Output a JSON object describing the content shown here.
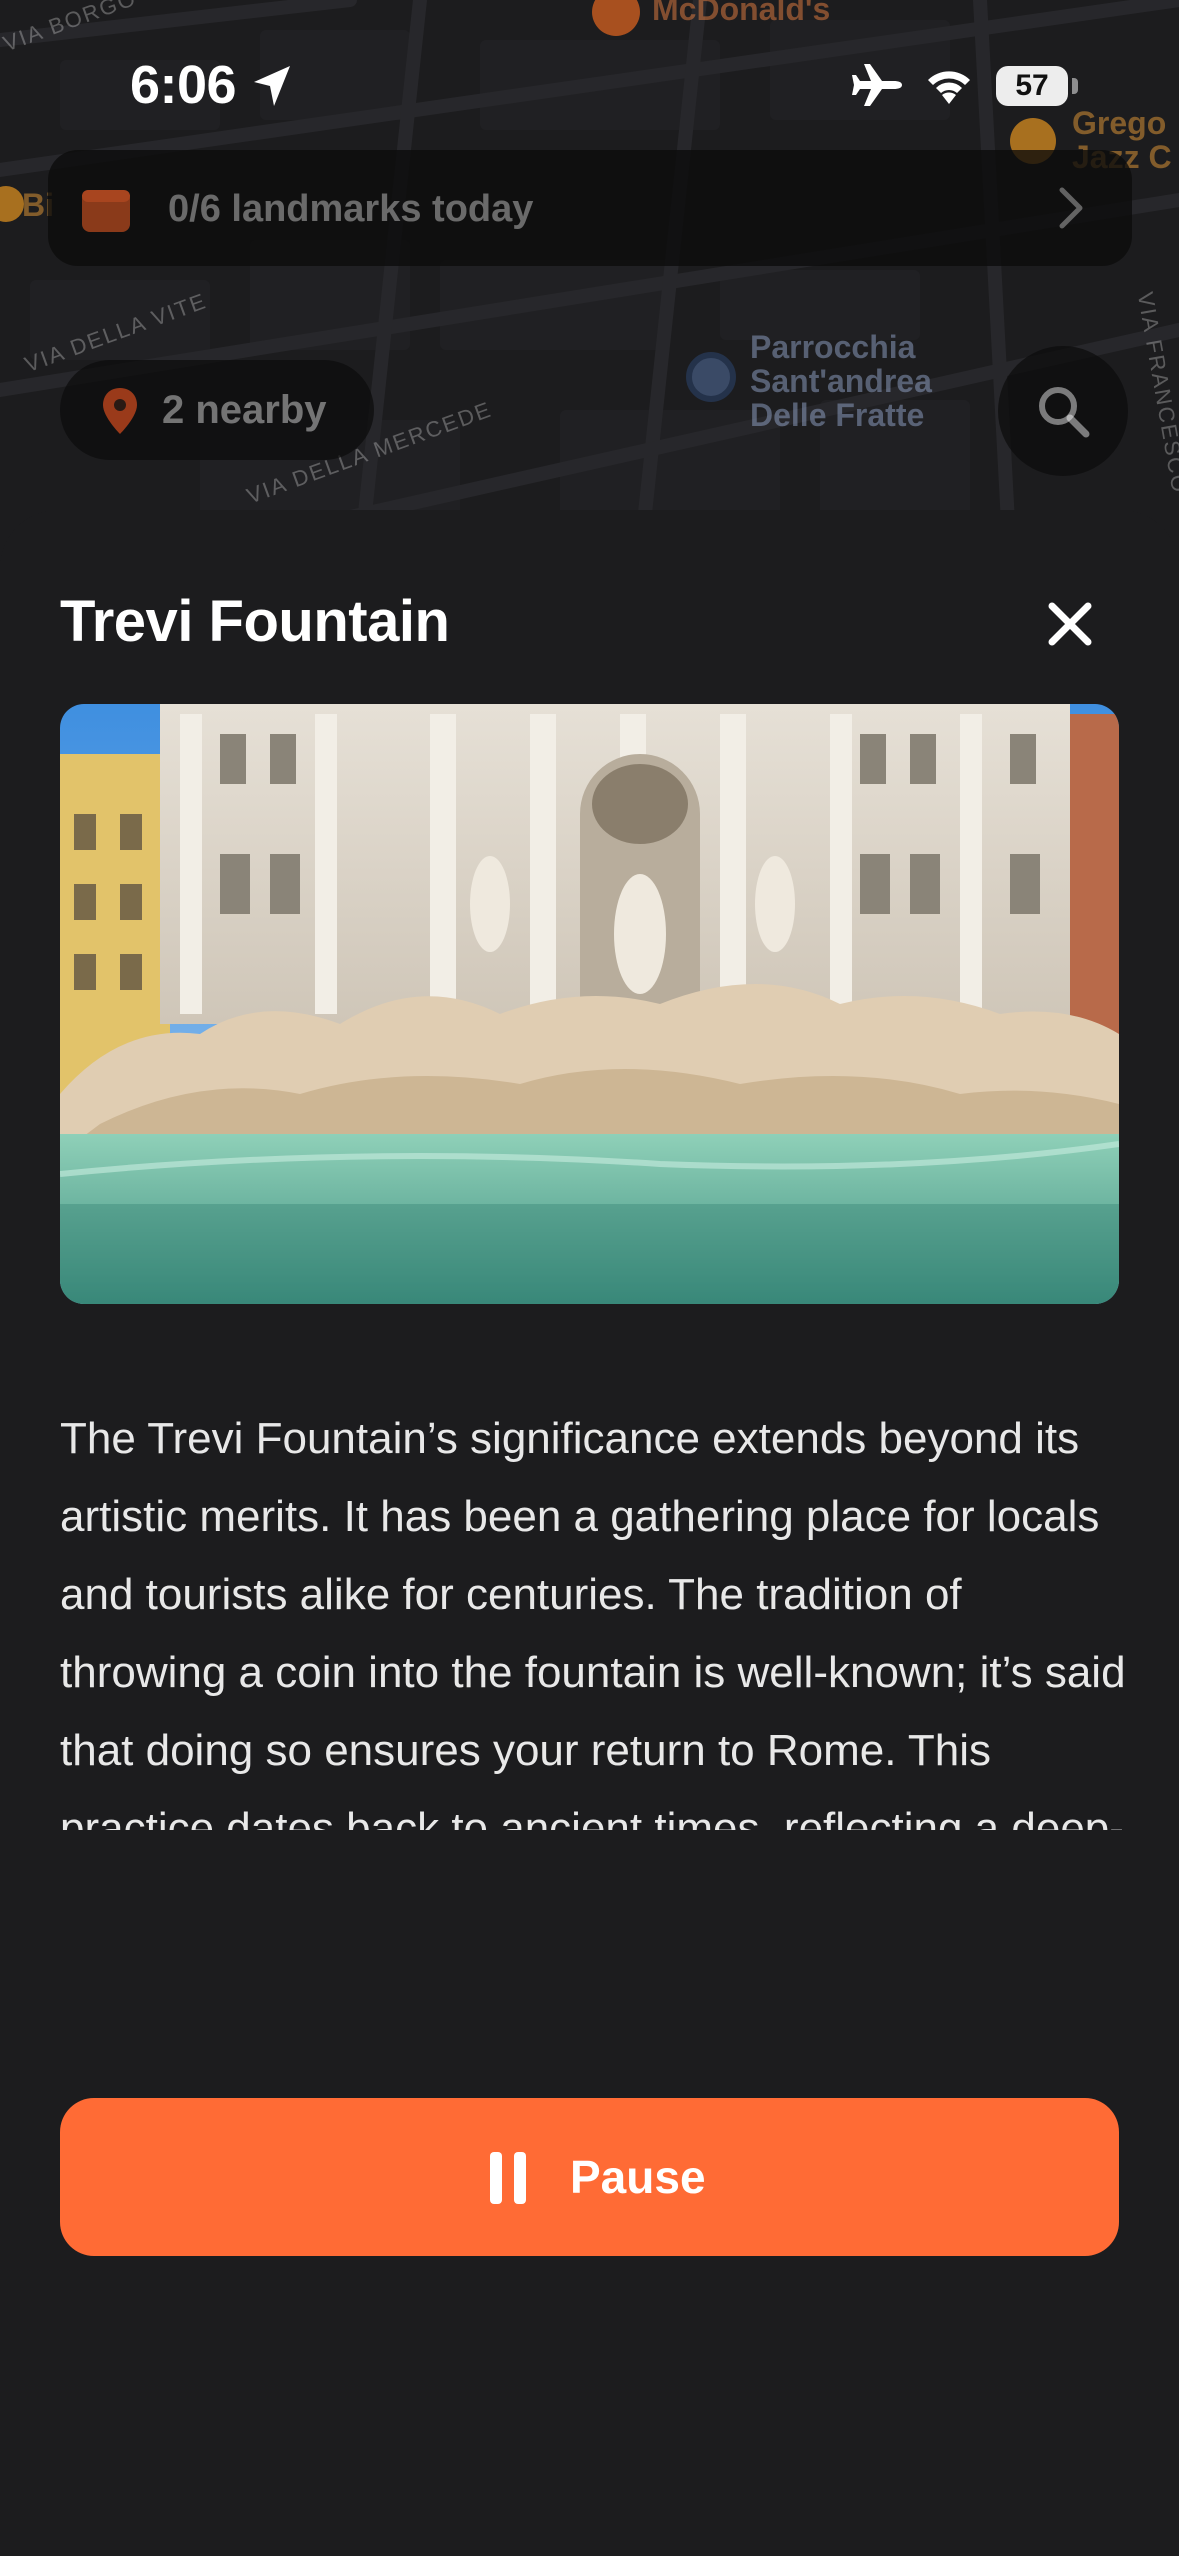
{
  "status_bar": {
    "time": "6:06",
    "battery": "57"
  },
  "map": {
    "street_labels": [
      "VIA BORGO",
      "VIA DELLA VITE",
      "VIA DELLA MERCEDE",
      "VIA FRANCESCO"
    ],
    "pois": {
      "mcdonalds": "McDonald's",
      "parrocchia": "Parrocchia\nSant'andrea\nDelle Fratte",
      "gregory": "Grego\nJazz C",
      "partial_left": "Bi"
    }
  },
  "landmarks_banner": {
    "text": "0/6 landmarks today"
  },
  "nearby": {
    "label": "2 nearby"
  },
  "sheet": {
    "title": "Trevi Fountain",
    "description": "The Trevi Fountain’s significance extends beyond its artistic merits. It has been a gathering place for locals and tourists alike for centuries. The tradition of throwing a coin into the fountain is well-known; it’s said that doing so ensures your return to Rome. This practice dates back to ancient times, reflecting a deep-rooted belief in the power of water as a connector of souls and",
    "button_label": "Pause"
  },
  "colors": {
    "accent": "#ff6b35",
    "sheet_bg": "#1c1c1e",
    "map_bg": "#2a2a2d"
  },
  "icons": {
    "location": "location-arrow-icon",
    "airplane": "airplane-mode-icon",
    "wifi": "wifi-icon",
    "calendar": "calendar-icon",
    "chevron": "chevron-right-icon",
    "pin": "map-pin-icon",
    "search": "search-icon",
    "close": "close-icon",
    "pause": "pause-icon"
  }
}
